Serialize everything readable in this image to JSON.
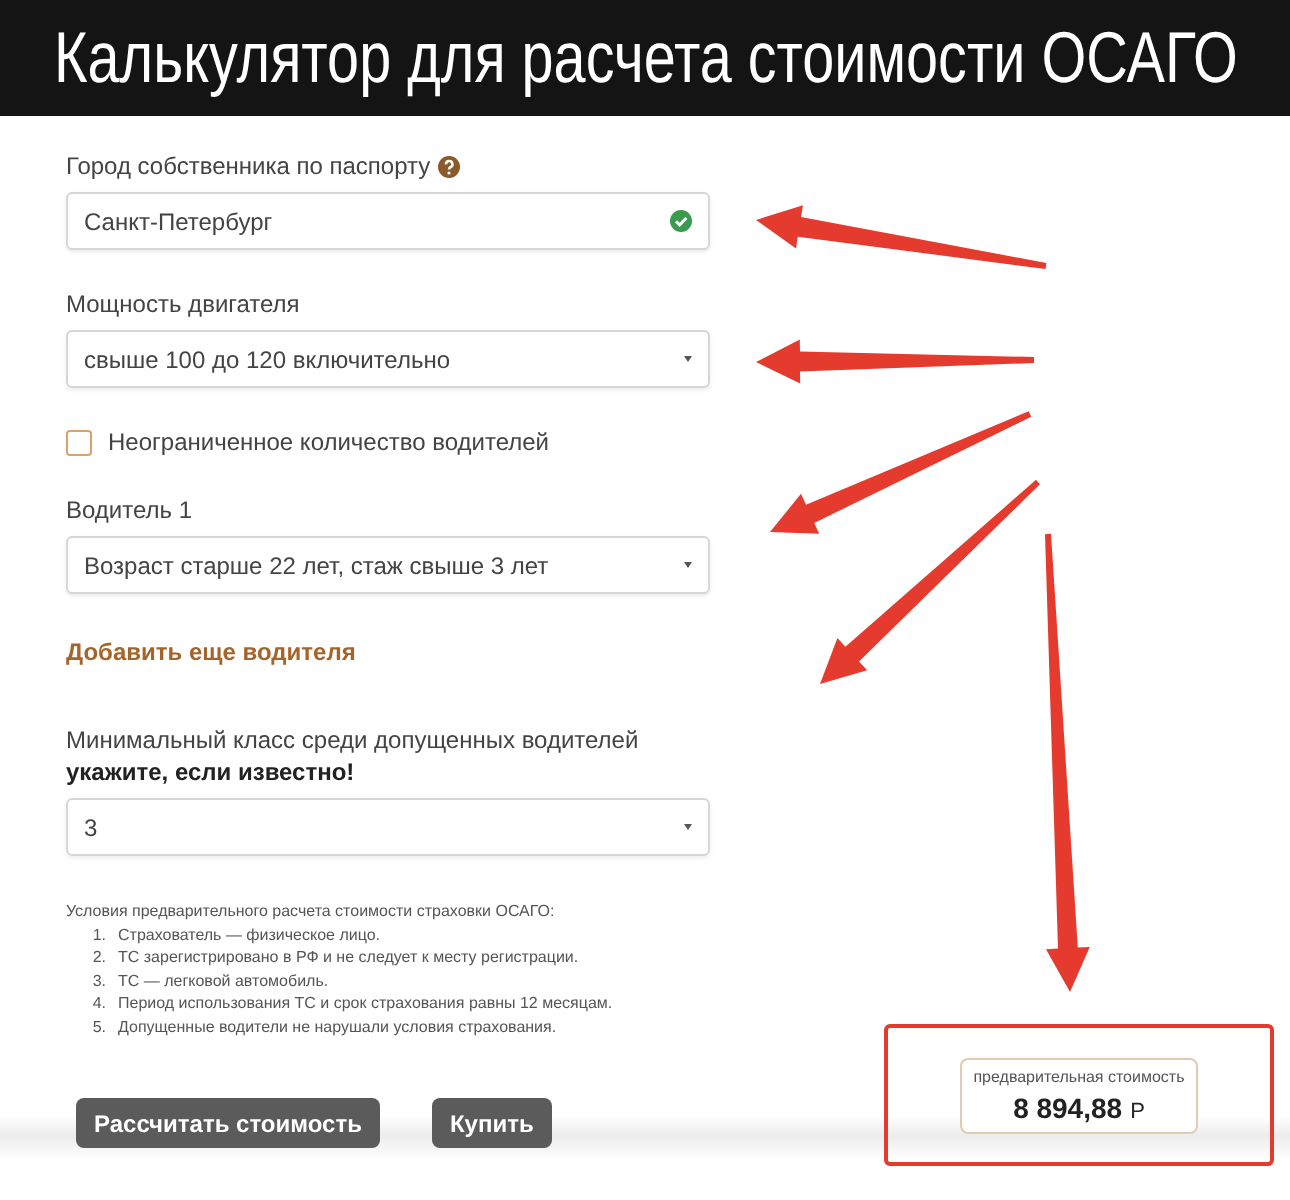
{
  "title": "Калькулятор для расчета стоимости ОСАГО",
  "form": {
    "fields": [
      {
        "kind": "text",
        "label": "Город собственника по паспорту",
        "help": true,
        "value": "Санкт-Петербург",
        "valid": true
      },
      {
        "kind": "select",
        "label": "Мощность двигателя",
        "value": "свыше 100 до 120 включительно"
      },
      {
        "kind": "checkbox",
        "label": "Неограниченное количество водителей",
        "checked": false
      },
      {
        "kind": "select",
        "label": "Водитель 1",
        "value": "Возраст старше 22 лет, стаж свыше 3 лет"
      },
      {
        "kind": "link",
        "label": "Добавить еще водителя"
      },
      {
        "kind": "select",
        "label": "Минимальный класс среди допущенных водителей",
        "note": "укажите, если известно!",
        "value": "3"
      }
    ]
  },
  "conditions": {
    "heading": "Условия предварительного расчета стоимости страховки ОСАГО:",
    "items": [
      {
        "number": "1.",
        "text": "Страхователь — физическое лицо."
      },
      {
        "number": "2.",
        "text": "ТС зарегистрировано в РФ и не следует к месту регистрации."
      },
      {
        "number": "3.",
        "text": "ТС — легковой автомобиль."
      },
      {
        "number": "4.",
        "text": "Период использования ТС и срок страхования равны 12 месяцам."
      },
      {
        "number": "5.",
        "text": "Допущенные водители не нарушали условия страхования."
      }
    ]
  },
  "buttons": [
    "Рассчитать стоимость",
    "Купить"
  ],
  "price": {
    "label": "предварительная стоимость",
    "value": "8 894,88",
    "currency": "Р"
  }
}
